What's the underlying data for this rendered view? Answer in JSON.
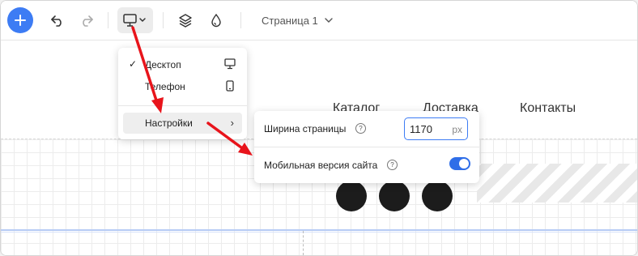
{
  "toolbar": {
    "add_icon": "plus-icon",
    "undo_icon": "undo-icon",
    "redo_icon": "redo-icon",
    "device_icon": "monitor-icon",
    "layers_icon": "layers-icon",
    "drop_icon": "drop-icon",
    "page_label": "Страница 1"
  },
  "canvas": {
    "nav": [
      "Каталог",
      "Доставка",
      "Контакты"
    ]
  },
  "device_menu": {
    "items": [
      {
        "label": "Десктоп",
        "checked": true,
        "icon": "monitor-icon"
      },
      {
        "label": "Телефон",
        "checked": false,
        "icon": "phone-icon"
      }
    ],
    "settings_label": "Настройки"
  },
  "settings_panel": {
    "width_label": "Ширина страницы",
    "width_value": "1170",
    "width_unit": "px",
    "mobile_label": "Мобильная версия сайта",
    "mobile_enabled": true
  },
  "colors": {
    "accent": "#3d7cf4",
    "annotation": "#e8141b"
  }
}
